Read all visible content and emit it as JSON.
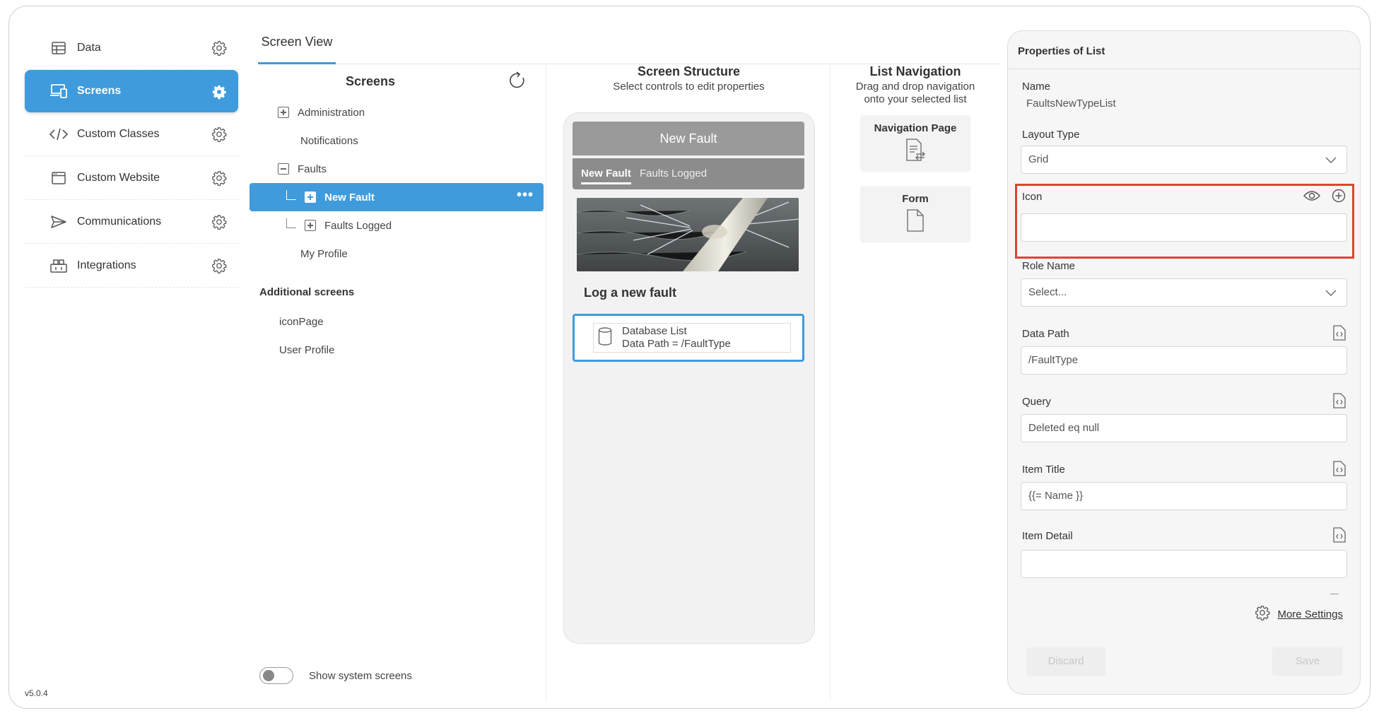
{
  "sidebar": {
    "items": [
      {
        "label": "Data",
        "icon": "table-icon"
      },
      {
        "label": "Screens",
        "icon": "devices-icon",
        "active": true
      },
      {
        "label": "Custom Classes",
        "icon": "code-icon"
      },
      {
        "label": "Custom Website",
        "icon": "browser-icon"
      },
      {
        "label": "Communications",
        "icon": "send-icon"
      },
      {
        "label": "Integrations",
        "icon": "integrations-icon"
      }
    ],
    "version": "v5.0.4"
  },
  "tabs": {
    "active": "Screen View"
  },
  "screens": {
    "title": "Screens",
    "tree": [
      {
        "label": "Administration",
        "type": "plus"
      },
      {
        "label": "Notifications",
        "type": "none"
      },
      {
        "label": "Faults",
        "type": "minus"
      },
      {
        "label": "New Fault",
        "type": "plus-child",
        "selected": true,
        "menu": "•••"
      },
      {
        "label": "Faults Logged",
        "type": "plus-child"
      },
      {
        "label": "My Profile",
        "type": "none"
      }
    ],
    "additional_title": "Additional screens",
    "additional": [
      "iconPage",
      "User Profile"
    ],
    "toggle_label": "Show system screens"
  },
  "structure": {
    "title": "Screen Structure",
    "subtitle": "Select controls to edit properties",
    "phone": {
      "header": "New Fault",
      "tab1": "New Fault",
      "tab2": "Faults Logged",
      "text": "Log a new fault",
      "db_line1": "Database List",
      "db_line2": "Data Path = /FaultType"
    }
  },
  "navigation": {
    "title": "List Navigation",
    "subtitle_line1": "Drag and drop navigation",
    "subtitle_line2": "onto your selected list",
    "cards": [
      "Navigation Page",
      "Form"
    ]
  },
  "properties": {
    "title": "Properties of List",
    "name_label": "Name",
    "name_value": "FaultsNewTypeList",
    "layout_label": "Layout Type",
    "layout_value": "Grid",
    "icon_label": "Icon",
    "icon_value": "",
    "role_label": "Role Name",
    "role_value": "Select...",
    "datapath_label": "Data Path",
    "datapath_value": "/FaultType",
    "query_label": "Query",
    "query_value": "Deleted eq null",
    "item_title_label": "Item Title",
    "item_title_value": "{{= Name }}",
    "item_detail_label": "Item Detail",
    "item_detail_value": "",
    "more_settings": "More Settings",
    "discard": "Discard",
    "save": "Save",
    "highlight_color": "#e0442f"
  },
  "colors": {
    "accent": "#3f9bdb",
    "phone_header": "#9a9a9a"
  }
}
